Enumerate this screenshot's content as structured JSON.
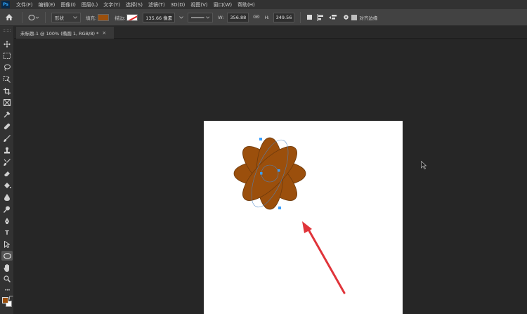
{
  "app": {
    "logo_text": "Ps"
  },
  "menu": [
    "文件(F)",
    "编辑(E)",
    "图像(I)",
    "图层(L)",
    "文字(Y)",
    "选择(S)",
    "滤镜(T)",
    "3D(D)",
    "视图(V)",
    "窗口(W)",
    "帮助(H)"
  ],
  "options": {
    "mode_value": "形状",
    "fill_label": "填充:",
    "fill_color": "#9b4f0c",
    "stroke_label": "描边:",
    "stroke_width": "135.66 像素",
    "w_label": "W:",
    "w_value": "356.88",
    "link_symbol": "GĐ",
    "h_label": "H:",
    "h_value": "349.56",
    "align_edges_label": "对齐边缘"
  },
  "document": {
    "tab_title": "未标题-1 @ 100% (椭圆 1, RGB/8) *",
    "close_symbol": "×"
  },
  "tools": {
    "type_tool_glyph": "T",
    "more_glyph": "•••"
  },
  "colors": {
    "foreground": "#9b4f0c",
    "background": "#ffffff",
    "annotation_arrow": "#e0343a",
    "path_anchor": "#3aa0ff"
  }
}
